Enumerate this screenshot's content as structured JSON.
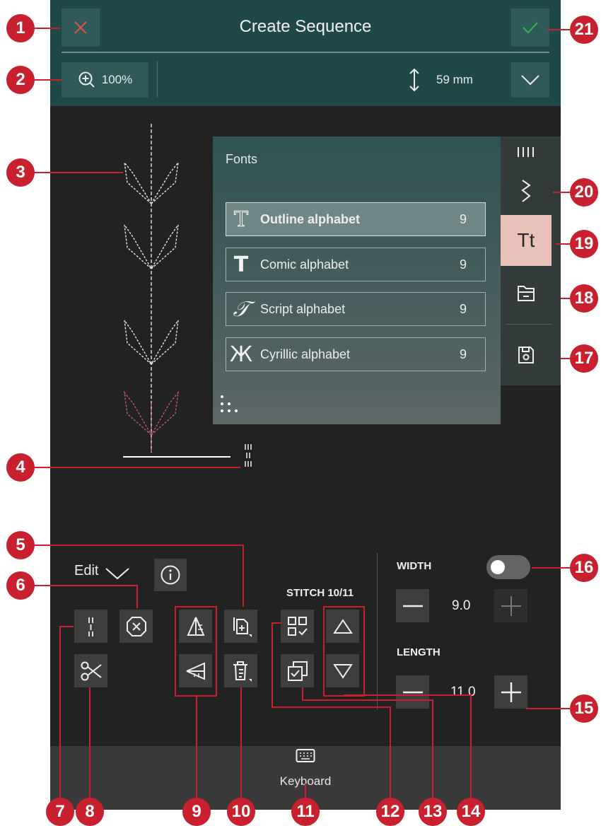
{
  "header": {
    "title": "Create Sequence",
    "zoom": "100%",
    "stitch_height": "59 mm"
  },
  "fonts_panel": {
    "title": "Fonts",
    "items": [
      {
        "glyph": "T",
        "label": "Outline alphabet",
        "count": "9",
        "selected": true
      },
      {
        "glyph": "T",
        "label": "Comic alphabet",
        "count": "9",
        "selected": false
      },
      {
        "glyph": "𝒯",
        "label": "Script alphabet",
        "count": "9",
        "selected": false
      },
      {
        "glyph": "Ж",
        "label": "Cyrillic alphabet",
        "count": "9",
        "selected": false
      }
    ]
  },
  "side_tabs": {
    "fonts_tab": "Tt"
  },
  "edit": {
    "label": "Edit"
  },
  "stitch": {
    "label": "STITCH 10/11"
  },
  "width": {
    "label": "WIDTH",
    "value": "9.0",
    "toggle_on": false
  },
  "length": {
    "label": "LENGTH",
    "value": "11.0"
  },
  "bottom": {
    "keyboard_label": "Keyboard"
  },
  "callouts": [
    "1",
    "2",
    "3",
    "4",
    "5",
    "6",
    "7",
    "8",
    "9",
    "10",
    "11",
    "12",
    "13",
    "14",
    "15",
    "16",
    "17",
    "18",
    "19",
    "20",
    "21"
  ],
  "colors": {
    "header_bg": "#1f4848",
    "callout_red": "#c8202f",
    "selected_tab": "#e8c1b8",
    "confirm_green": "#2fb34a",
    "cancel_red": "#e04c4c"
  }
}
